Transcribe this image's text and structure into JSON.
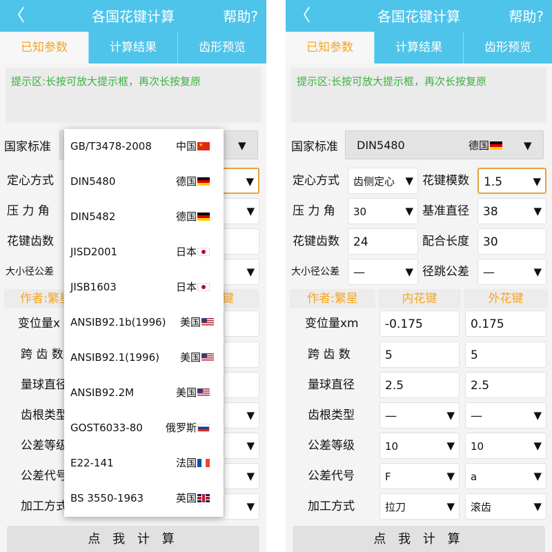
{
  "header": {
    "back": "〈",
    "title": "各国花键计算",
    "help": "帮助?"
  },
  "tabs": [
    "已知参数",
    "计算结果",
    "齿形预览"
  ],
  "hint": "提示区:长按可放大提示框，再次长按复原",
  "labels": {
    "standard": "国家标准",
    "centering": "定心方式",
    "pressure_angle": "压 力 角",
    "teeth": "花键齿数",
    "dia_tol": "大小径公差",
    "module": "花键模数",
    "ref_dia": "基准直径",
    "fit_length": "配合长度",
    "runout_tol": "径跳公差",
    "author": "作者:繁星",
    "internal": "内花键",
    "external": "外花键",
    "shift": "变位量xm",
    "span": "跨 齿 数",
    "ball": "量球直径",
    "root": "齿根类型",
    "grade": "公差等级",
    "code": "公差代号",
    "process": "加工方式"
  },
  "left": {
    "truncated_labels": {
      "author": "作者:繁星",
      "internal_tail": "键",
      "shift": "变位量x",
      "span": "跨 齿 数",
      "root": "齿根类型",
      "grade": "公差等级",
      "code": "公差代号",
      "process": "加工方式"
    }
  },
  "right": {
    "standard": {
      "value": "DIN5480",
      "country": "德国",
      "flag": "de"
    },
    "centering": "齿侧定心",
    "module": "1.5",
    "pressure_angle": "30",
    "ref_dia": "38",
    "teeth": "24",
    "fit_length": "30",
    "dia_tol": "—",
    "runout_tol": "—",
    "internal": {
      "shift": "-0.175",
      "span": "5",
      "ball": "2.5",
      "root": "—",
      "grade": "10",
      "code": "F",
      "process": "拉刀"
    },
    "external": {
      "shift": "0.175",
      "span": "5",
      "ball": "2.5",
      "root": "—",
      "grade": "10",
      "code": "a",
      "process": "滚齿"
    }
  },
  "dropdown": [
    {
      "name": "GB/T3478-2008",
      "country": "中国",
      "flag": "cn"
    },
    {
      "name": "DIN5480",
      "country": "德国",
      "flag": "de"
    },
    {
      "name": "DIN5482",
      "country": "德国",
      "flag": "de"
    },
    {
      "name": "JISD2001",
      "country": "日本",
      "flag": "jp"
    },
    {
      "name": "JISB1603",
      "country": "日本",
      "flag": "jp"
    },
    {
      "name": "ANSIB92.1b(1996)",
      "country": "美国",
      "flag": "us"
    },
    {
      "name": "ANSIB92.1(1996)",
      "country": "美国",
      "flag": "us"
    },
    {
      "name": "ANSIB92.2M",
      "country": "美国",
      "flag": "us"
    },
    {
      "name": "GOST6033-80",
      "country": "俄罗斯",
      "flag": "ru"
    },
    {
      "name": "E22-141",
      "country": "法国",
      "flag": "fr"
    },
    {
      "name": "BS 3550-1963",
      "country": "英国",
      "flag": "gb"
    }
  ],
  "calc_button": "点 我 计 算",
  "colors": {
    "accent": "#4fc4ea",
    "active_tab_text": "#f5a623",
    "hint_text": "#3cb043",
    "focus_border": "#e8a23c"
  }
}
